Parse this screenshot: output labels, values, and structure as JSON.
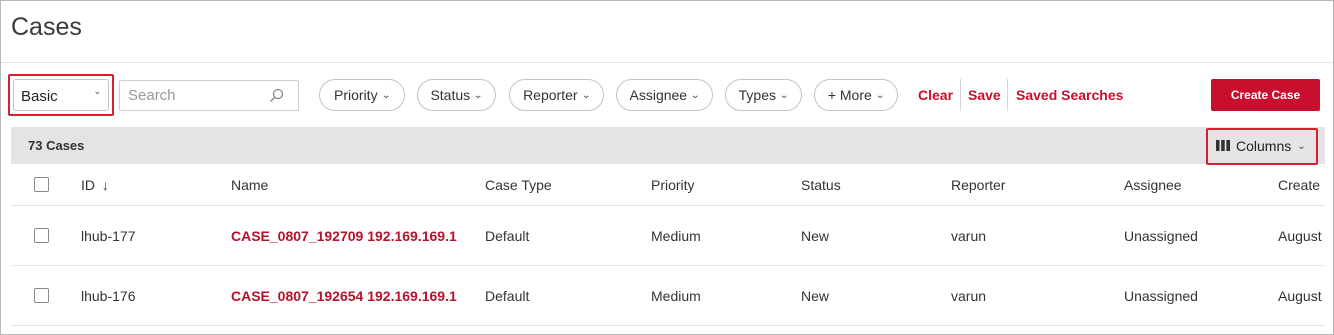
{
  "page": {
    "title": "Cases"
  },
  "toolbar": {
    "search_mode": "Basic",
    "search_placeholder": "Search",
    "filters": [
      "Priority",
      "Status",
      "Reporter",
      "Assignee",
      "Types",
      "+ More"
    ],
    "clear_label": "Clear",
    "save_label": "Save",
    "saved_searches_label": "Saved Searches",
    "create_label": "Create Case"
  },
  "summary": {
    "count_label": "73 Cases",
    "columns_label": "Columns"
  },
  "table": {
    "headers": [
      "ID",
      "Name",
      "Case Type",
      "Priority",
      "Status",
      "Reporter",
      "Assignee",
      "Create"
    ],
    "sort_indicator": "↓",
    "rows": [
      {
        "id": "lhub-177",
        "name": "CASE_0807_192709 192.169.169.1",
        "case_type": "Default",
        "priority": "Medium",
        "status": "New",
        "reporter": "varun",
        "assignee": "Unassigned",
        "created": "August"
      },
      {
        "id": "lhub-176",
        "name": "CASE_0807_192654 192.169.169.1",
        "case_type": "Default",
        "priority": "Medium",
        "status": "New",
        "reporter": "varun",
        "assignee": "Unassigned",
        "created": "August"
      }
    ]
  },
  "colors": {
    "accent": "#c8102e",
    "highlight": "#d5212e",
    "summary_bg": "#e4e4e6"
  },
  "icons": {
    "search": "magnifier-icon",
    "columns": "columns-icon",
    "sort": "sort-down-icon",
    "dropdown": "chevron-down-icon"
  }
}
